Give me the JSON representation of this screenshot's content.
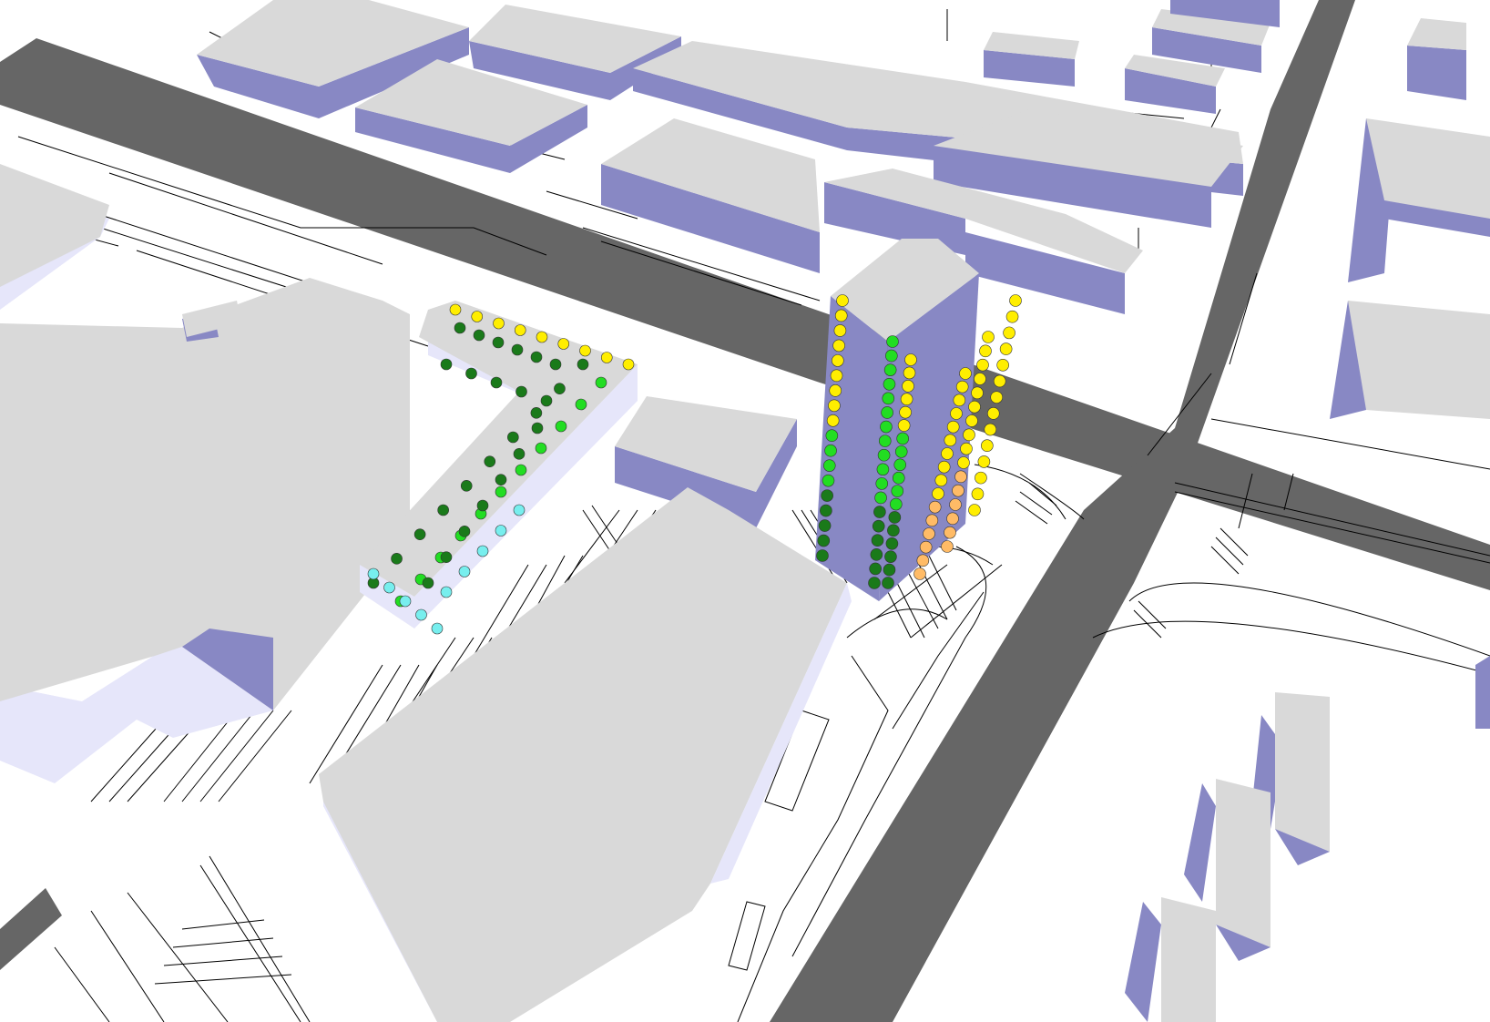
{
  "scene": {
    "kind": "3d-city-model-noise-facade-view",
    "background": "#ffffff",
    "colors": {
      "road": "#666666",
      "roof": "#d9d9d9",
      "wall_dark": "#8888c4",
      "wall_light": "#e6e6fa",
      "linework": "#000000"
    },
    "receiver_colors": {
      "dark_green": "#1a7a1a",
      "green": "#22dd22",
      "light_green": "#66ee66",
      "cyan": "#77eeee",
      "yellow": "#ffee00",
      "orange": "#ffbb66"
    },
    "icons": [
      "building-block-icon",
      "road-icon",
      "receiver-point-icon"
    ]
  }
}
